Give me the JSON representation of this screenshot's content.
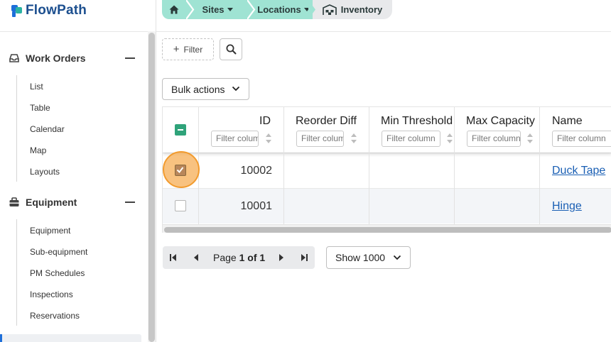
{
  "app": {
    "brand": "FlowPath"
  },
  "breadcrumb": {
    "home_icon": "home-icon",
    "items": [
      {
        "label": "Sites"
      },
      {
        "label": "Locations"
      },
      {
        "label": "Inventory",
        "icon": "warehouse-icon"
      }
    ]
  },
  "sidebar": {
    "sections": [
      {
        "title": "Work Orders",
        "icon": "inbox-icon",
        "items": [
          "List",
          "Table",
          "Calendar",
          "Map",
          "Layouts"
        ]
      },
      {
        "title": "Equipment",
        "icon": "equipment-icon",
        "items": [
          "Equipment",
          "Sub-equipment",
          "PM Schedules",
          "Inspections",
          "Reservations"
        ]
      }
    ]
  },
  "toolbar": {
    "filter_label": "Filter",
    "bulk_actions_label": "Bulk actions"
  },
  "table": {
    "columns": [
      {
        "title": "ID",
        "filter_placeholder": "Filter column"
      },
      {
        "title": "Reorder Diff",
        "filter_placeholder": "Filter column"
      },
      {
        "title": "Min Threshold",
        "filter_placeholder": "Filter column"
      },
      {
        "title": "Max Capacity",
        "filter_placeholder": "Filter column"
      },
      {
        "title": "Name",
        "filter_placeholder": "Filter column"
      }
    ],
    "rows": [
      {
        "id": "10002",
        "name": "Duck Tape",
        "checked": true
      },
      {
        "id": "10001",
        "name": "Hinge",
        "checked": false
      }
    ]
  },
  "pagination": {
    "page_word": "Page",
    "current_range": "1 of 1",
    "page_size_label": "Show 1000"
  },
  "colors": {
    "breadcrumb_active": "#9fe3d3",
    "link": "#1a5fb4",
    "accent": "#1e6fd9",
    "checkbox_checked": "#2fa37a",
    "highlight": "#f29b2e"
  }
}
